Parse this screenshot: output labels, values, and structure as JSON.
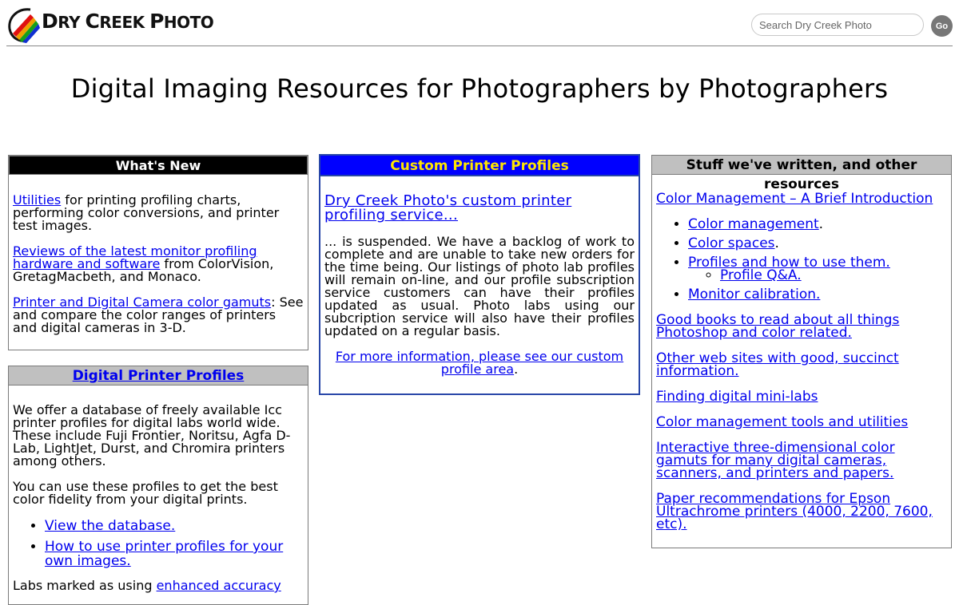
{
  "header": {
    "brand_first": "D",
    "brand_rest1": "RY ",
    "brand_c": "C",
    "brand_rest2": "REEK ",
    "brand_p": "P",
    "brand_rest3": "HOTO",
    "search_placeholder": "Search Dry Creek Photo",
    "go_label": "Go"
  },
  "page_title": "Digital Imaging Resources for Photographers by Photographers",
  "whats_new": {
    "heading": "What's New",
    "items": [
      {
        "link": "Utilities",
        "text": " for printing profiling charts, performing color conversions, and printer test images."
      },
      {
        "link": "Reviews of the latest monitor profiling hardware and software",
        "text": " from ColorVision, GretagMacbeth, and Monaco."
      },
      {
        "link": "Printer and Digital Camera color gamuts",
        "text": ": See and compare the color ranges of printers and digital cameras in 3-D."
      }
    ]
  },
  "digital_profiles": {
    "heading": "Digital Printer Profiles",
    "para1": "We offer a database of freely available Icc printer profiles for digital labs world wide. These include Fuji Frontier, Noritsu, Agfa D-Lab, LightJet, Durst, and Chromira printers among others.",
    "para2": "You can use these profiles to get the best color fidelity from your digital prints.",
    "links": [
      "View the database.",
      "How to use printer profiles for your own images."
    ],
    "tail_text": "Labs marked as using ",
    "tail_link": "enhanced accuracy"
  },
  "custom_profiles": {
    "heading": "Custom Printer Profiles",
    "lead_link": "Dry Creek Photo's custom printer profiling service...",
    "body": "... is suspended. We have a backlog of work to complete and are unable to take new orders for the time being. Our listings of photo lab profiles will remain on-line, and our profile subscription service customers can have their profiles updated as usual. Photo labs using our subcription service will also have their profiles updated on a regular basis.",
    "more_link": "For more information, please see our custom profile area",
    "more_end": "."
  },
  "stuff": {
    "heading": "Stuff we've written, and other resources",
    "intro_link": "Color Management – A Brief Introduction",
    "list": [
      {
        "link": "Color management",
        "suffix": "."
      },
      {
        "link": "Color spaces",
        "suffix": "."
      },
      {
        "link": "Profiles and how to use them.",
        "suffix": ""
      },
      {
        "link": "Monitor calibration.",
        "suffix": ""
      }
    ],
    "sub_link": "Profile Q&A.",
    "links": [
      "Good books to read about all things Photoshop and color related.",
      "Other web sites with good, succinct information.",
      "Finding digital mini-labs",
      "Color management tools and utilities",
      "Interactive three-dimensional color gamuts for many digital cameras, scanners, and printers and papers.",
      "Paper recommendations for Epson Ultrachrome printers (4000, 2200, 7600, etc)."
    ]
  }
}
